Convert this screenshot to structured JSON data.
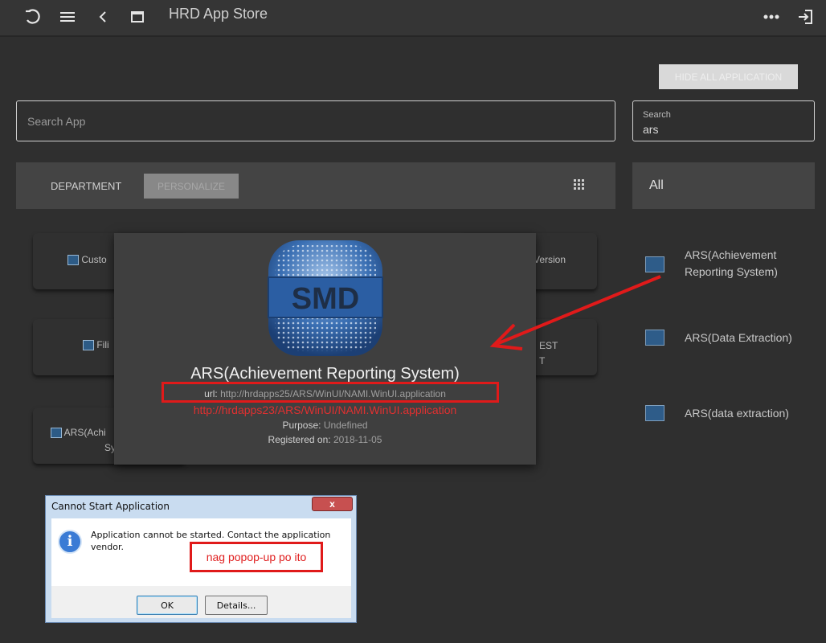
{
  "app": {
    "title": "HRD App Store"
  },
  "toolbar": {
    "hide_all_label": "HIDE ALL APPLICATION"
  },
  "search": {
    "main_placeholder": "Search App",
    "side_label": "Search",
    "side_value": "ars"
  },
  "main_panel": {
    "tabs": [
      {
        "label": "DEPARTMENT"
      },
      {
        "label": "PERSONALIZE"
      }
    ],
    "cards": [
      {
        "label": "Custo"
      },
      {
        "label": "Version"
      },
      {
        "label": "Fili"
      },
      {
        "label_line1": "EST",
        "label_line2": "T"
      },
      {
        "label_line1": "ARS(Achi",
        "label_line2": "Sy"
      }
    ]
  },
  "side_panel": {
    "header": "All",
    "items": [
      {
        "label": "ARS(Achievement Reporting System)"
      },
      {
        "label": "ARS(Data Extraction)"
      },
      {
        "label": "ARS(data extraction)"
      }
    ]
  },
  "detail": {
    "logo_text": "SMD",
    "title": "ARS(Achievement Reporting System)",
    "url_label": "url:",
    "url_value": "http://hrdapps25/ARS/WinUI/NAMI.WinUI.application",
    "corrected_url": "http://hrdapps23/ARS/WinUI/NAMI.WinUI.application",
    "purpose_label": "Purpose:",
    "purpose_value": "Undefined",
    "registered_label": "Registered on:",
    "registered_value": "2018-11-05"
  },
  "dialog": {
    "title": "Cannot Start Application",
    "close_label": "x",
    "message": "Application cannot be started. Contact the application vendor.",
    "ok_label": "OK",
    "details_label": "Details...",
    "annotation": "nag popop-up po ito"
  },
  "colors": {
    "annotation_red": "#e01a1a",
    "background": "#2f2f2f",
    "header": "#444444"
  },
  "icons": [
    "logo-icon",
    "menu-icon",
    "back-icon",
    "window-icon",
    "more-icon",
    "logout-icon",
    "grid-icon",
    "app-icon",
    "info-icon"
  ]
}
